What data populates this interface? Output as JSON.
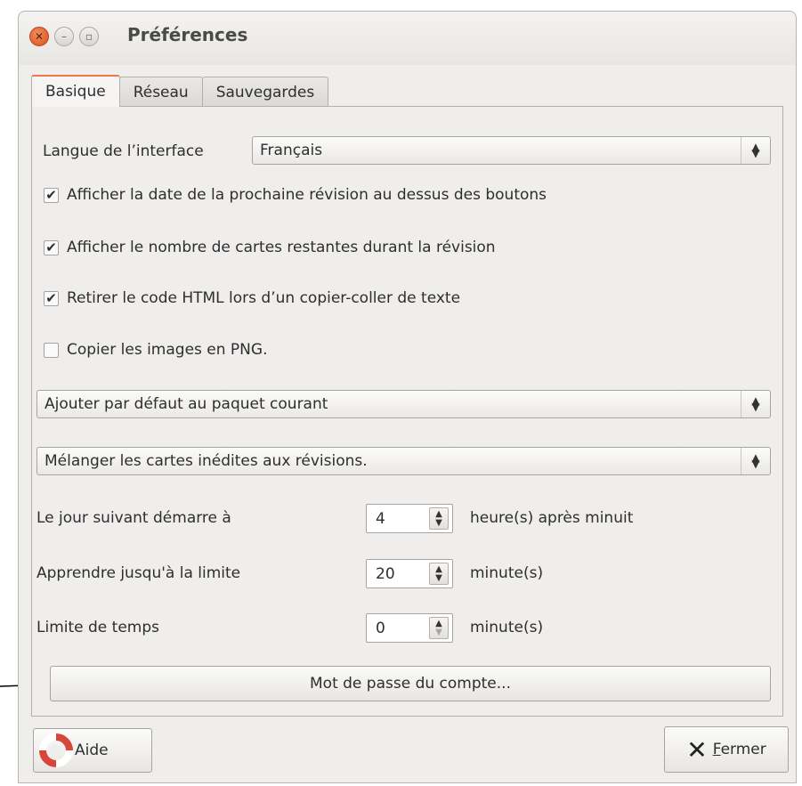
{
  "window": {
    "title": "Préférences"
  },
  "tabs": [
    {
      "label": "Basique"
    },
    {
      "label": "Réseau"
    },
    {
      "label": "Sauvegardes"
    }
  ],
  "basic": {
    "language_label": "Langue de l’interface",
    "language_value": "Français",
    "checkboxes": [
      {
        "label": "Afficher la date de la prochaine révision au dessus des boutons",
        "checked": true
      },
      {
        "label": "Afficher le nombre de cartes restantes durant la révision",
        "checked": true
      },
      {
        "label": "Retirer le code HTML lors d’un copier-coller de texte",
        "checked": true
      },
      {
        "label": "Copier les images en PNG.",
        "checked": false
      }
    ],
    "add_default_value": "Ajouter par défaut au paquet courant",
    "mix_cards_value": "Mélanger les cartes inédites aux révisions.",
    "spinners": [
      {
        "label": "Le jour suivant démarre à",
        "value": "4",
        "unit": "heure(s) après minuit"
      },
      {
        "label": "Apprendre jusqu'à la limite",
        "value": "20",
        "unit": "minute(s)"
      },
      {
        "label": "Limite de temps",
        "value": "0",
        "unit": "minute(s)"
      }
    ],
    "password_button": "Mot de passe du compte..."
  },
  "footer": {
    "help_label": "Aide",
    "close_mnemonic": "F",
    "close_rest": "ermer"
  },
  "colors": {
    "accent": "#e8794a",
    "close_button": "#d9501c",
    "window_bg": "#efeeec"
  }
}
